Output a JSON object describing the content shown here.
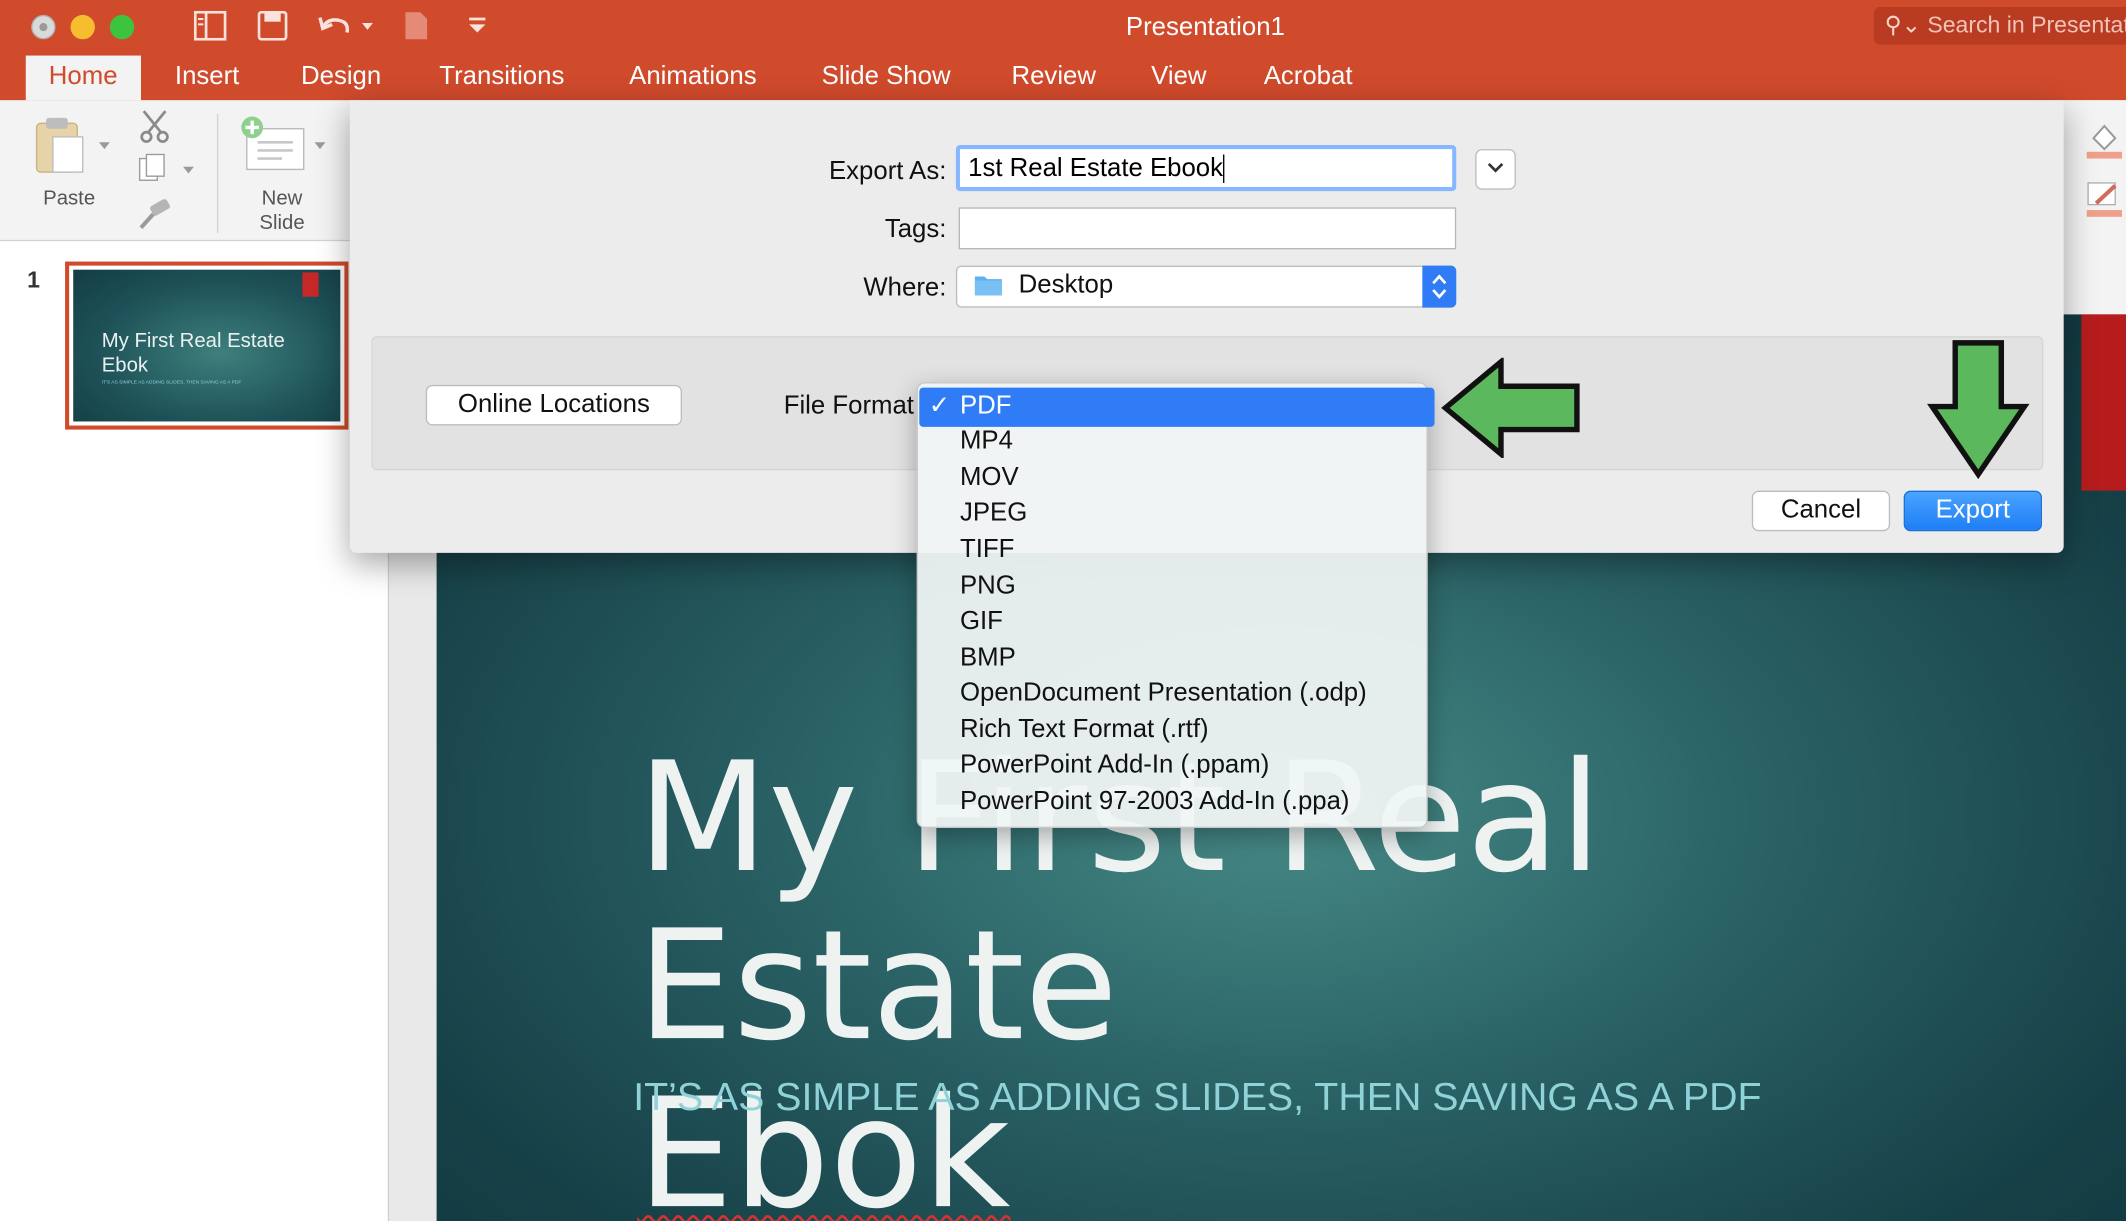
{
  "window": {
    "title": "Presentation1",
    "search_placeholder": "Search in Presentation"
  },
  "ribbon_tabs": [
    "Home",
    "Insert",
    "Design",
    "Transitions",
    "Animations",
    "Slide Show",
    "Review",
    "View",
    "Acrobat"
  ],
  "ribbon": {
    "paste_label": "Paste",
    "new_slide_label_1": "New",
    "new_slide_label_2": "Slide"
  },
  "sidebar": {
    "slide_number": "1",
    "thumb_title": "My First Real Estate Ebok",
    "thumb_subtitle": "IT'S AS SIMPLE AS ADDING SLIDES, THEN SAVING AS A PDF"
  },
  "slide": {
    "title_line1": "My First Real Estate",
    "title_line2": "Ebok",
    "subtitle": "IT’S AS SIMPLE AS ADDING SLIDES, THEN SAVING AS A PDF"
  },
  "dialog": {
    "export_as_label": "Export As:",
    "export_as_value": "1st Real Estate Ebook",
    "tags_label": "Tags:",
    "tags_value": "",
    "where_label": "Where:",
    "where_value": "Desktop",
    "online_locations_label": "Online Locations",
    "file_format_label": "File Format",
    "cancel_label": "Cancel",
    "export_label": "Export",
    "format_selected": "PDF",
    "checkmark": "✓",
    "formats": [
      "PDF",
      "MP4",
      "MOV",
      "JPEG",
      "TIFF",
      "PNG",
      "GIF",
      "BMP",
      "OpenDocument Presentation (.odp)",
      "Rich Text Format (.rtf)",
      "PowerPoint Add-In (.ppam)",
      "PowerPoint 97-2003 Add-In (.ppa)"
    ]
  },
  "colors": {
    "accent": "#d04a2c",
    "select_blue": "#2f7cf6",
    "arrow_green": "#5cb85c"
  }
}
